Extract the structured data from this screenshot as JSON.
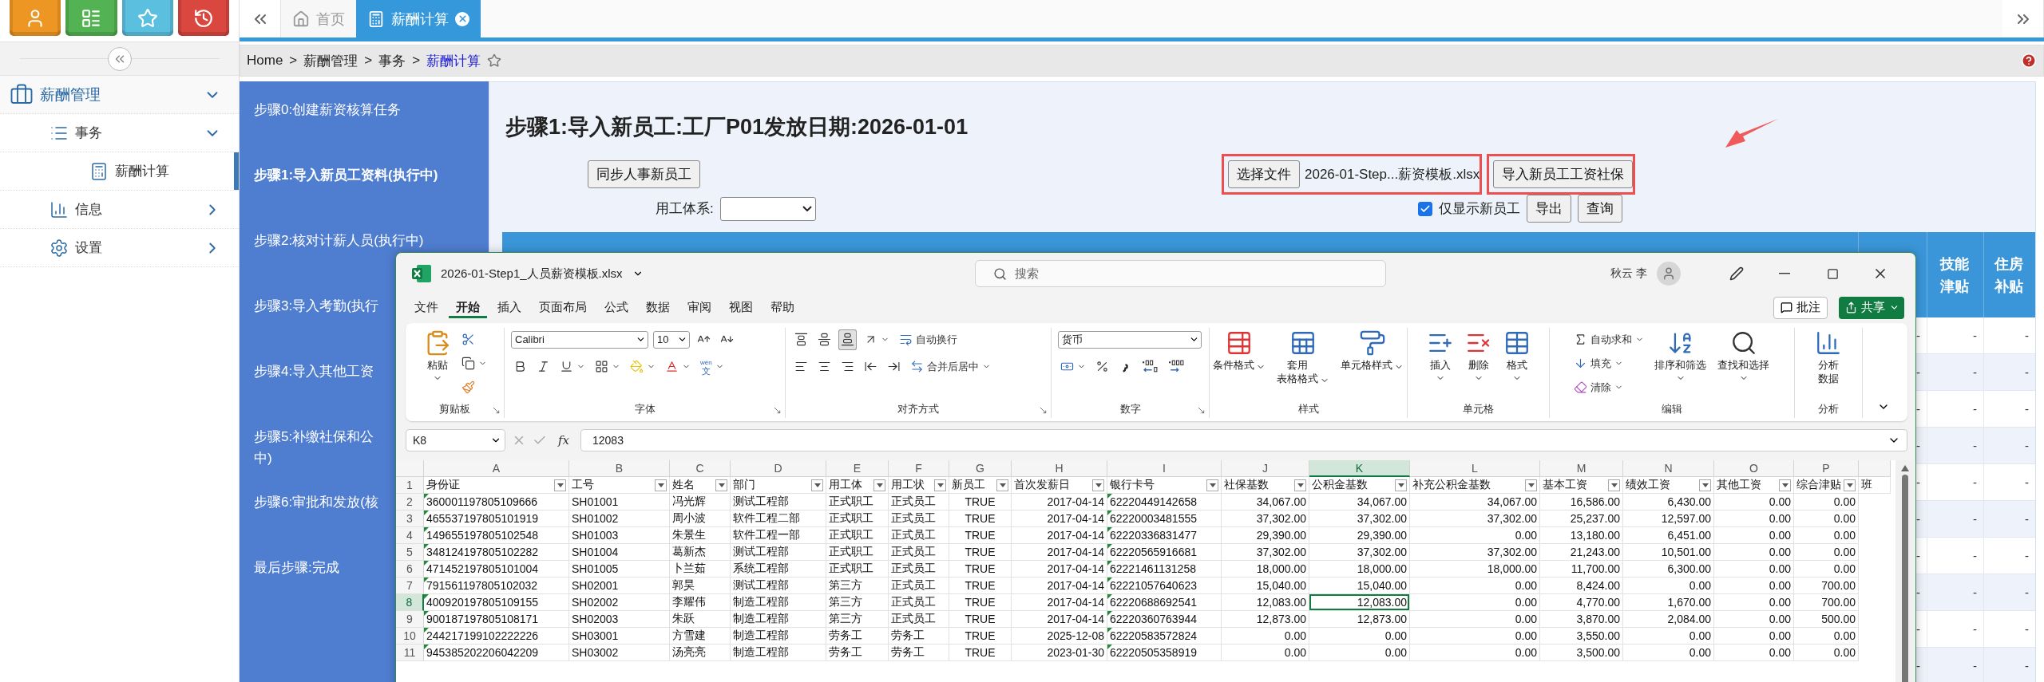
{
  "launcher": [
    {
      "kind": "user",
      "color": "#ee9623"
    },
    {
      "kind": "list",
      "color": "#53b251"
    },
    {
      "kind": "star",
      "color": "#5bbfdf"
    },
    {
      "kind": "history",
      "color": "#d9473f"
    }
  ],
  "sidebar": {
    "items": [
      {
        "label": "薪酬管理",
        "kind": "module",
        "selected": false,
        "expanded": true,
        "children": [
          {
            "label": "事务",
            "kind": "list",
            "selected": false,
            "expanded": true,
            "children": [
              {
                "label": "薪酬计算",
                "kind": "calc",
                "selected": true
              }
            ]
          },
          {
            "label": "信息",
            "kind": "chart",
            "selected": false,
            "expanded": false
          },
          {
            "label": "设置",
            "kind": "gear",
            "selected": false,
            "expanded": false
          }
        ]
      }
    ]
  },
  "tabs": [
    {
      "label": "首页",
      "kind": "home",
      "selected": false
    },
    {
      "label": "薪酬计算",
      "kind": "calc",
      "selected": true
    }
  ],
  "breadcrumb": {
    "items": [
      "Home",
      "薪酬管理",
      "事务",
      "薪酬计算"
    ],
    "separator": ">"
  },
  "steps": [
    {
      "lines": [
        "步骤0:创建薪资核算任务"
      ],
      "selected": false
    },
    {
      "lines": [
        "步骤1:导入新员工资料(执行中)"
      ],
      "selected": true
    },
    {
      "lines": [
        "步骤2:核对计薪人员(执行中)"
      ],
      "selected": false
    },
    {
      "lines": [
        "步骤3:导入考勤(执行"
      ],
      "selected": false
    },
    {
      "lines": [
        "步骤4:导入其他工资"
      ],
      "selected": false
    },
    {
      "lines": [
        "步骤5:补缴社保和公",
        "中)"
      ],
      "selected": false
    },
    {
      "lines": [
        "步骤6:审批和发放(核"
      ],
      "selected": false
    },
    {
      "lines": [
        "最后步骤:完成"
      ],
      "selected": false
    }
  ],
  "page_title": "步骤1:导入新员工:工厂P01发放日期:2026-01-01",
  "toolbar": {
    "sync_button": "同步人事新员工",
    "employment_label": "用工体系:",
    "file_button": "选择文件",
    "file_name": "2026-01-Step...薪资模板.xlsx",
    "import_button": "导入新员工工资社保",
    "only_new": {
      "label": "仅显示新员工",
      "checked": true
    },
    "export_button": "导出",
    "query_button": "查询"
  },
  "table": {
    "columns": [
      "技能津贴",
      "住房补贴"
    ],
    "rows": [
      {
        "cells": [
          "-",
          "-",
          "-"
        ]
      },
      {
        "cells": [
          "-",
          "-",
          "-"
        ]
      },
      {
        "cells": [
          "-",
          "-",
          "-"
        ]
      },
      {
        "cells": [
          "-",
          "-",
          "-"
        ]
      },
      {
        "cells": [
          "-",
          "-",
          "-"
        ]
      },
      {
        "cells": [
          "-",
          "-",
          "-"
        ]
      },
      {
        "cells": [
          "-",
          "-",
          "-"
        ]
      },
      {
        "cells": [
          "-",
          "-",
          "-"
        ]
      },
      {
        "cells": [
          "-",
          "-",
          "-"
        ]
      },
      {
        "cells": [
          "-",
          "-",
          "-"
        ]
      }
    ]
  },
  "excel": {
    "title": "2026-01-Step1_人员薪资模板.xlsx",
    "search_placeholder": "搜索",
    "user": "秋云 李",
    "menu": [
      {
        "label": "文件",
        "selected": false
      },
      {
        "label": "开始",
        "selected": true
      },
      {
        "label": "插入",
        "selected": false
      },
      {
        "label": "页面布局",
        "selected": false
      },
      {
        "label": "公式",
        "selected": false
      },
      {
        "label": "数据",
        "selected": false
      },
      {
        "label": "审阅",
        "selected": false
      },
      {
        "label": "视图",
        "selected": false
      },
      {
        "label": "帮助",
        "selected": false
      }
    ],
    "comment_button": "批注",
    "share_button": "共享",
    "ribbon": [
      {
        "title": "剪贴板",
        "columns": [
          {
            "kind": "paste",
            "lines": [
              "粘贴"
            ],
            "caret": true
          },
          {
            "items": [
              {
                "kind": "cut"
              },
              {
                "kind": "copy",
                "caret": true
              },
              {
                "kind": "painter"
              }
            ]
          }
        ]
      },
      {
        "title": "字体",
        "rows": [
          [
            {
              "kind": "select",
              "value": "Calibri"
            },
            {
              "kind": "select",
              "value": "10"
            },
            {
              "kind": "grow"
            },
            {
              "kind": "shrink"
            }
          ],
          [
            {
              "kind": "bold"
            },
            {
              "kind": "italic"
            },
            {
              "kind": "underline",
              "caret": true
            },
            {
              "kind": "border",
              "caret": true
            },
            {
              "kind": "fill",
              "caret": true
            },
            {
              "kind": "font-color",
              "caret": true
            },
            {
              "kind": "phonetic",
              "glyphs": [
                "wén",
                "文"
              ],
              "caret": true
            }
          ]
        ]
      },
      {
        "title": "对齐方式",
        "rows": [
          [
            {
              "kind": "valign-top",
              "selected": false
            },
            {
              "kind": "valign-middle",
              "selected": false
            },
            {
              "kind": "valign-bottom",
              "selected": true
            },
            {
              "kind": "orientation",
              "caret": true
            },
            {
              "kind": "wrap",
              "label": "自动换行"
            }
          ],
          [
            {
              "kind": "align-left"
            },
            {
              "kind": "align-center"
            },
            {
              "kind": "align-right"
            },
            {
              "kind": "indent-dec"
            },
            {
              "kind": "indent-inc"
            },
            {
              "kind": "merge",
              "label": "合并后居中",
              "caret": true
            }
          ]
        ]
      },
      {
        "title": "数字",
        "rows": [
          [
            {
              "kind": "select",
              "value": "货币"
            }
          ],
          [
            {
              "kind": "accounting",
              "caret": true
            },
            {
              "kind": "percent"
            },
            {
              "kind": "comma"
            },
            {
              "kind": "inc-decimal"
            },
            {
              "kind": "dec-decimal"
            }
          ]
        ]
      },
      {
        "title": "样式",
        "columns": [
          {
            "kind": "cond-format",
            "lines": [
              "条件格式"
            ],
            "caret": true
          },
          {
            "kind": "table-format",
            "lines": [
              "套用",
              "表格格式"
            ],
            "caret": true
          },
          {
            "kind": "cell-style",
            "lines": [
              "单元格样式"
            ],
            "caret": true
          }
        ]
      },
      {
        "title": "单元格",
        "columns": [
          {
            "kind": "insert",
            "lines": [
              "插入"
            ],
            "caret": true
          },
          {
            "kind": "delete",
            "lines": [
              "删除"
            ],
            "caret": true
          },
          {
            "kind": "format",
            "lines": [
              "格式"
            ],
            "caret": true
          }
        ]
      },
      {
        "title": "编辑",
        "columns": [
          {
            "items": [
              {
                "kind": "sum",
                "label": "自动求和",
                "caret": true
              },
              {
                "kind": "fill-down",
                "label": "填充",
                "caret": true
              },
              {
                "kind": "clear",
                "label": "清除",
                "caret": true
              }
            ]
          },
          {
            "kind": "sort",
            "lines": [
              "排序和筛选"
            ],
            "caret": true
          },
          {
            "kind": "find",
            "lines": [
              "查找和选择"
            ],
            "caret": true
          }
        ]
      },
      {
        "title": "分析",
        "columns": [
          {
            "kind": "analyze",
            "lines": [
              "分析",
              "数据"
            ]
          }
        ]
      }
    ],
    "name_box": "K8",
    "fx": "fx",
    "formula": "12083",
    "columns": [
      {
        "letter": "A",
        "header": "身份证",
        "kind": "numtext",
        "selected": false
      },
      {
        "letter": "B",
        "header": "工号",
        "kind": "text",
        "selected": false
      },
      {
        "letter": "C",
        "header": "姓名",
        "kind": "text",
        "selected": false
      },
      {
        "letter": "D",
        "header": "部门",
        "kind": "text",
        "selected": false
      },
      {
        "letter": "E",
        "header": "用工体",
        "kind": "text",
        "selected": false
      },
      {
        "letter": "F",
        "header": "用工状",
        "kind": "text",
        "selected": false
      },
      {
        "letter": "G",
        "header": "新员工",
        "kind": "bool",
        "selected": false
      },
      {
        "letter": "H",
        "header": "首次发薪日",
        "kind": "date",
        "selected": false
      },
      {
        "letter": "I",
        "header": "银行卡号",
        "kind": "numtext",
        "selected": false
      },
      {
        "letter": "J",
        "header": "社保基数",
        "kind": "number",
        "selected": false
      },
      {
        "letter": "K",
        "header": "公积金基数",
        "kind": "number",
        "selected": true
      },
      {
        "letter": "L",
        "header": "补充公积金基数",
        "kind": "number",
        "selected": false
      },
      {
        "letter": "M",
        "header": "基本工资",
        "kind": "number",
        "selected": false
      },
      {
        "letter": "N",
        "header": "绩效工资",
        "kind": "number",
        "selected": false
      },
      {
        "letter": "O",
        "header": "其他工资",
        "kind": "number",
        "selected": false
      },
      {
        "letter": "P",
        "header": "综合津贴",
        "kind": "number",
        "selected": false
      },
      {
        "header": "班",
        "kind": "text",
        "selected": false
      }
    ],
    "header_row": "1",
    "rows": [
      {
        "num": "2",
        "selected": false,
        "cells": [
          "360001197805109666",
          "SH01001",
          "冯光辉",
          "测试工程部",
          "正式职工",
          "正式员工",
          "TRUE",
          "2017-04-14",
          "62220449142658",
          "34,067.00",
          "34,067.00",
          "34,067.00",
          "16,586.00",
          "6,430.00",
          "0.00",
          "0.00"
        ]
      },
      {
        "num": "3",
        "selected": false,
        "cells": [
          "465537197805101919",
          "SH01002",
          "周小波",
          "软件工程二部",
          "正式职工",
          "正式员工",
          "TRUE",
          "2017-04-14",
          "62220003481555",
          "37,302.00",
          "37,302.00",
          "37,302.00",
          "25,237.00",
          "12,597.00",
          "0.00",
          "0.00"
        ]
      },
      {
        "num": "4",
        "selected": false,
        "cells": [
          "149655197805102548",
          "SH01003",
          "朱景生",
          "软件工程一部",
          "正式职工",
          "正式员工",
          "TRUE",
          "2017-04-14",
          "62220336831477",
          "29,390.00",
          "29,390.00",
          "0.00",
          "13,180.00",
          "6,451.00",
          "0.00",
          "0.00"
        ]
      },
      {
        "num": "5",
        "selected": false,
        "cells": [
          "348124197805102282",
          "SH01004",
          "葛新杰",
          "测试工程部",
          "正式职工",
          "正式员工",
          "TRUE",
          "2017-04-14",
          "62220565916681",
          "37,302.00",
          "37,302.00",
          "37,302.00",
          "21,243.00",
          "10,501.00",
          "0.00",
          "0.00"
        ]
      },
      {
        "num": "6",
        "selected": false,
        "cells": [
          "471452197805101004",
          "SH01005",
          "卜兰茹",
          "系统工程部",
          "正式职工",
          "正式员工",
          "TRUE",
          "2017-04-14",
          "62221461131258",
          "18,000.00",
          "18,000.00",
          "18,000.00",
          "11,700.00",
          "6,300.00",
          "0.00",
          "0.00"
        ]
      },
      {
        "num": "7",
        "selected": false,
        "cells": [
          "791561197805102032",
          "SH02001",
          "郭昊",
          "测试工程部",
          "第三方",
          "正式员工",
          "TRUE",
          "2017-04-14",
          "62221057640623",
          "15,040.00",
          "15,040.00",
          "0.00",
          "8,424.00",
          "0.00",
          "0.00",
          "700.00"
        ]
      },
      {
        "num": "8",
        "selected": true,
        "cells": [
          "400920197805109155",
          "SH02002",
          "李耀伟",
          "制造工程部",
          "第三方",
          "正式员工",
          "TRUE",
          "2017-04-14",
          "62220688692541",
          "12,083.00",
          "12,083.00",
          "0.00",
          "4,770.00",
          "1,670.00",
          "0.00",
          "700.00"
        ]
      },
      {
        "num": "9",
        "selected": false,
        "cells": [
          "900187197805108171",
          "SH02003",
          "朱跃",
          "制造工程部",
          "第三方",
          "正式员工",
          "TRUE",
          "2017-04-14",
          "62220360763944",
          "12,873.00",
          "12,873.00",
          "0.00",
          "3,870.00",
          "2,084.00",
          "0.00",
          "500.00"
        ]
      },
      {
        "num": "10",
        "selected": false,
        "cells": [
          "244217199102222226",
          "SH03001",
          "方雪建",
          "制造工程部",
          "劳务工",
          "劳务工",
          "TRUE",
          "2025-12-08",
          "62220583572824",
          "0.00",
          "0.00",
          "0.00",
          "3,550.00",
          "0.00",
          "0.00",
          "0.00"
        ]
      },
      {
        "num": "11",
        "selected": false,
        "cells": [
          "945385202206042209",
          "SH03002",
          "汤亮亮",
          "制造工程部",
          "劳务工",
          "劳务工",
          "TRUE",
          "2023-01-30",
          "62220505358919",
          "0.00",
          "0.00",
          "0.00",
          "3,500.00",
          "0.00",
          "0.00",
          "0.00"
        ]
      }
    ]
  }
}
